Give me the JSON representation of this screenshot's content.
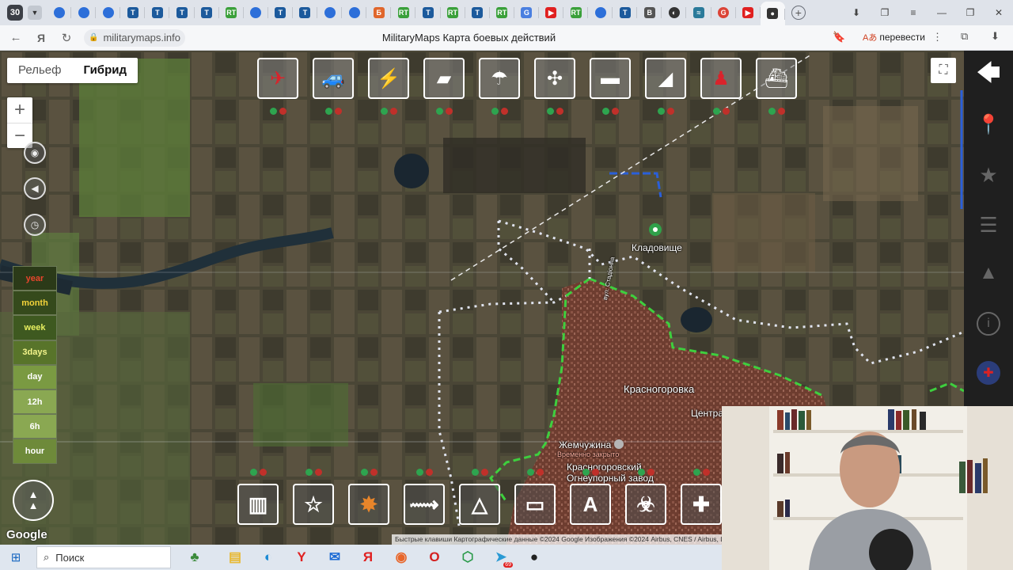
{
  "browser": {
    "tab_count": "30",
    "tabs": [
      {
        "icon": "edge-icon",
        "color": "#2d6fd9",
        "glyph": ""
      },
      {
        "icon": "edge-icon",
        "color": "#2d6fd9",
        "glyph": ""
      },
      {
        "icon": "edge-icon",
        "color": "#2d6fd9",
        "glyph": ""
      },
      {
        "icon": "t-icon",
        "color": "#1c5a9c",
        "glyph": "T"
      },
      {
        "icon": "t-icon",
        "color": "#1c5a9c",
        "glyph": "T"
      },
      {
        "icon": "t-icon",
        "color": "#1c5a9c",
        "glyph": "T"
      },
      {
        "icon": "t-icon",
        "color": "#1c5a9c",
        "glyph": "T"
      },
      {
        "icon": "ria-icon",
        "color": "#3aa03a",
        "glyph": "RT"
      },
      {
        "icon": "edge-icon",
        "color": "#2d6fd9",
        "glyph": ""
      },
      {
        "icon": "t-icon",
        "color": "#1c5a9c",
        "glyph": "T"
      },
      {
        "icon": "t-icon",
        "color": "#1c5a9c",
        "glyph": "T"
      },
      {
        "icon": "edge-icon",
        "color": "#2d6fd9",
        "glyph": ""
      },
      {
        "icon": "edge-icon",
        "color": "#2d6fd9",
        "glyph": ""
      },
      {
        "icon": "b-icon",
        "color": "#e0662c",
        "glyph": "Б"
      },
      {
        "icon": "ria-icon",
        "color": "#3aa03a",
        "glyph": "RT"
      },
      {
        "icon": "t-icon",
        "color": "#1c5a9c",
        "glyph": "T"
      },
      {
        "icon": "ria-icon",
        "color": "#3aa03a",
        "glyph": "RT"
      },
      {
        "icon": "t-icon",
        "color": "#1c5a9c",
        "glyph": "T"
      },
      {
        "icon": "ria-icon",
        "color": "#3aa03a",
        "glyph": "RT"
      },
      {
        "icon": "translate-icon",
        "color": "#4a7fe0",
        "glyph": "G"
      },
      {
        "icon": "youtube-icon",
        "color": "#e02020",
        "glyph": "▶"
      },
      {
        "icon": "ria-icon",
        "color": "#3aa03a",
        "glyph": "RT"
      },
      {
        "icon": "edge-icon",
        "color": "#2d6fd9",
        "glyph": ""
      },
      {
        "icon": "t-icon",
        "color": "#1c5a9c",
        "glyph": "T"
      },
      {
        "icon": "b-letter-icon",
        "color": "#555555",
        "glyph": "B"
      },
      {
        "icon": "circle-icon",
        "color": "#333333",
        "glyph": "◐"
      },
      {
        "icon": "chart-icon",
        "color": "#2a7a9a",
        "glyph": "≈"
      },
      {
        "icon": "google-icon",
        "color": "#db4437",
        "glyph": "G"
      },
      {
        "icon": "youtube-icon",
        "color": "#e02020",
        "glyph": "▶"
      },
      {
        "icon": "militarymaps-icon",
        "color": "#333333",
        "glyph": "●"
      }
    ],
    "url": "militarymaps.info",
    "title": "MilitaryMaps Карта боевых действий",
    "translate_label": "перевести"
  },
  "map": {
    "maptype": {
      "relief": "Рельеф",
      "hybrid": "Гибрид"
    },
    "zoom_in": "+",
    "zoom_out": "−",
    "time_filters": [
      {
        "label": "year",
        "bg": "#2b3a18",
        "fg": "#e8452c"
      },
      {
        "label": "month",
        "bg": "#354a1c",
        "fg": "#f3d33a"
      },
      {
        "label": "week",
        "bg": "#3e5920",
        "fg": "#e8f060"
      },
      {
        "label": "3days",
        "bg": "#58742a",
        "fg": "#f4f58c"
      },
      {
        "label": "day",
        "bg": "#7a9a42",
        "fg": "#ffffff"
      },
      {
        "label": "12h",
        "bg": "#8aa852",
        "fg": "#ffffff"
      },
      {
        "label": "6h",
        "bg": "#8aa852",
        "fg": "#ffffff"
      },
      {
        "label": "hour",
        "bg": "#6e8a3a",
        "fg": "#ffffff"
      }
    ],
    "unit_buttons": [
      {
        "name": "aircraft-icon",
        "glyph": "✈",
        "color": "#d9232b"
      },
      {
        "name": "armored-car-icon",
        "glyph": "🚙",
        "color": "#ffffff"
      },
      {
        "name": "missile-launcher-icon",
        "glyph": "⚡",
        "color": "#ffffff"
      },
      {
        "name": "artillery-icon",
        "glyph": "▰",
        "color": "#ffffff"
      },
      {
        "name": "paratrooper-icon",
        "glyph": "☂",
        "color": "#ffffff"
      },
      {
        "name": "helicopter-icon",
        "glyph": "✣",
        "color": "#ffffff"
      },
      {
        "name": "tank-icon",
        "glyph": "▬",
        "color": "#ffffff"
      },
      {
        "name": "self-propelled-gun-icon",
        "glyph": "◢",
        "color": "#ffffff"
      },
      {
        "name": "soldier-icon",
        "glyph": "♟",
        "color": "#d9232b"
      },
      {
        "name": "ship-icon",
        "glyph": "⛴",
        "color": "#ffffff"
      }
    ],
    "tool_buttons": [
      {
        "name": "fortification-icon",
        "glyph": "▥"
      },
      {
        "name": "star-icon",
        "glyph": "☆"
      },
      {
        "name": "explosion-icon",
        "glyph": "✸"
      },
      {
        "name": "route-icon",
        "glyph": "⟿"
      },
      {
        "name": "triangle-path-icon",
        "glyph": "△"
      },
      {
        "name": "ruler-icon",
        "glyph": "▭"
      },
      {
        "name": "text-icon",
        "glyph": "A"
      },
      {
        "name": "biohazard-icon",
        "glyph": "☣"
      },
      {
        "name": "medical-icon",
        "glyph": "✚"
      }
    ],
    "labels": {
      "cemetery": "Кладовище",
      "town": "Красногоровка",
      "center": "Центра",
      "zhemchuzhina": "Жемчужина",
      "temp_closed": "Временно закрыто",
      "factory": "Красногоровский",
      "factory2": "Огнеупорный завод",
      "road": "вул. Стадіонна"
    },
    "google": "Google",
    "attribution": "Быстрые клавиши   Картографические данные ©2024 Google Изображения ©2024 Airbus, CNES / Airbus, L"
  },
  "taskbar": {
    "search": "Поиск",
    "apps": [
      "trees-icon",
      "explorer-icon",
      "edge-icon",
      "yandex-y-icon",
      "mail-icon",
      "yandex-icon",
      "firefox-icon",
      "opera-icon",
      "shield-icon",
      "telegram-icon",
      "app-icon"
    ],
    "telegram_badge": "69"
  }
}
